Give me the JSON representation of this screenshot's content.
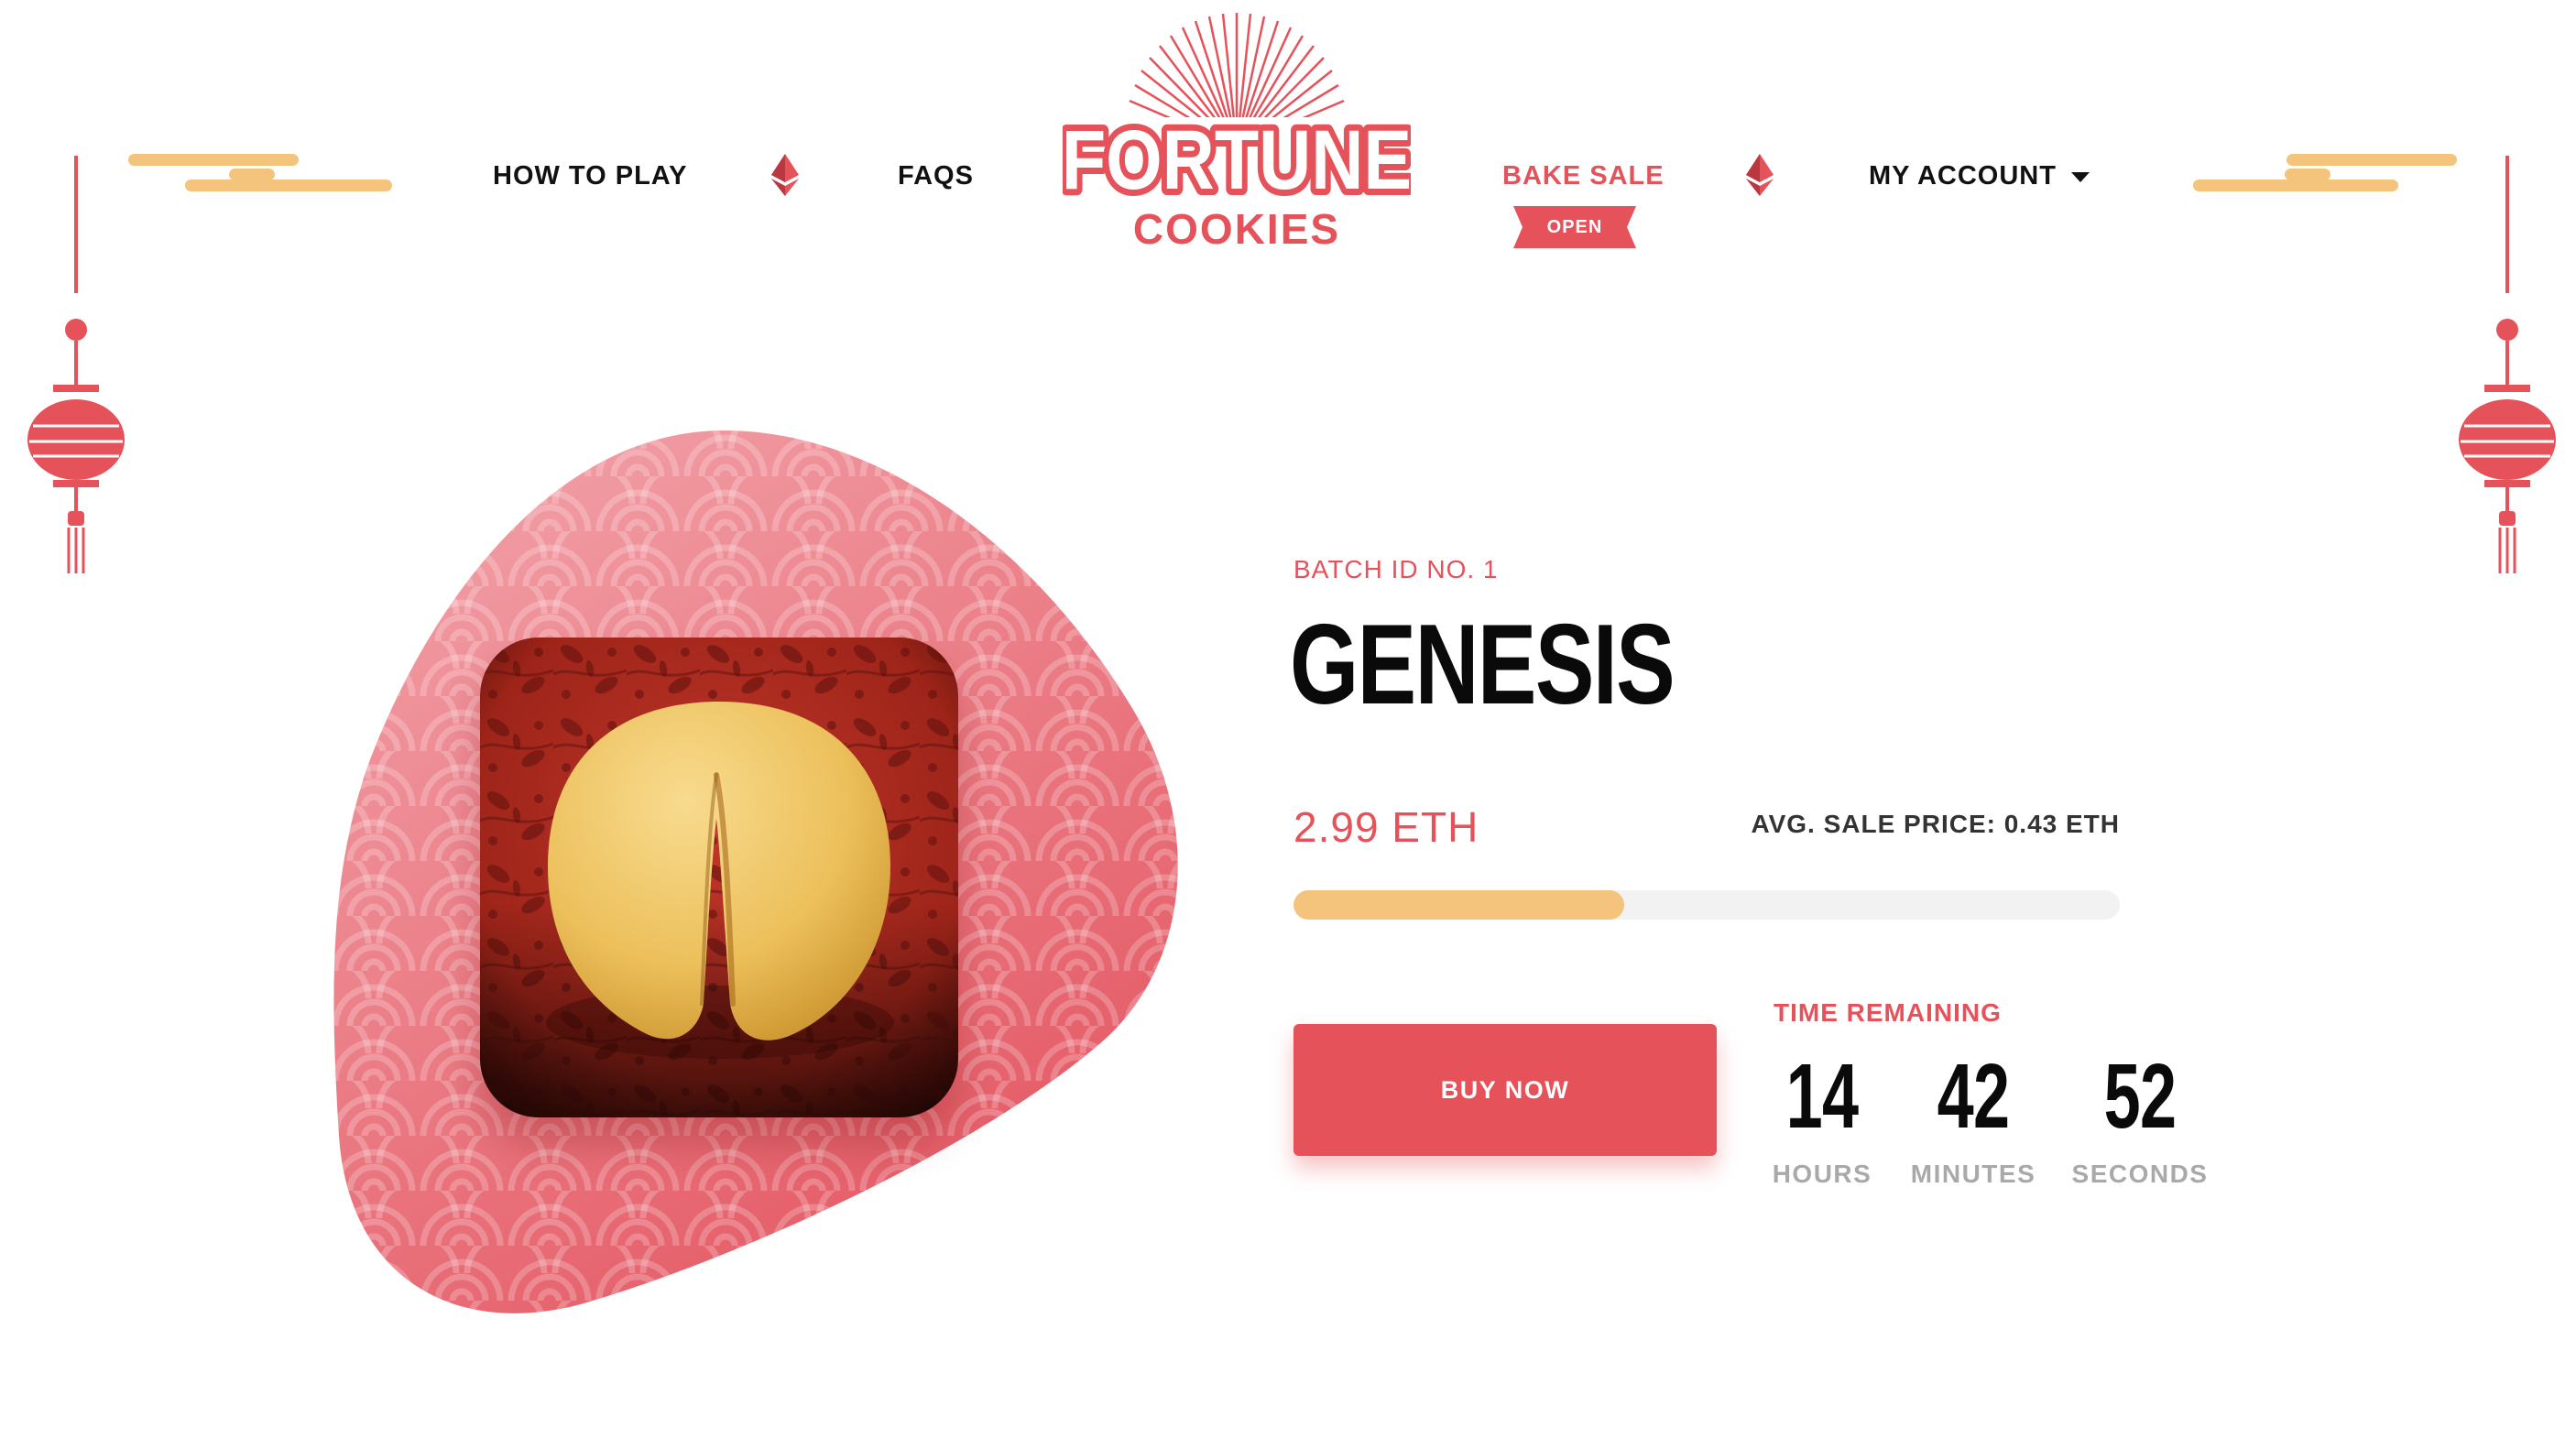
{
  "colors": {
    "accent": "#e5525a",
    "gold": "#f4c37c",
    "text": "#111111",
    "muted": "#a9a9a9"
  },
  "logo": {
    "word1": "FORTUNE",
    "word2": "COOKIES"
  },
  "nav": {
    "how_to_play": "HOW TO PLAY",
    "faqs": "FAQS",
    "bake_sale": "BAKE SALE",
    "bake_sale_badge": "OPEN",
    "my_account": "MY ACCOUNT",
    "divider_icon": "ethereum-diamond-icon",
    "account_icon": "caret-down-icon"
  },
  "decor": {
    "cloud_icon": "cloud-icon",
    "lantern_icon": "lantern-icon"
  },
  "artwork": {
    "subject_icon": "fortune-cookie-icon"
  },
  "batch": {
    "label": "BATCH ID NO. 1",
    "name": "GENESIS",
    "price": "2.99 ETH",
    "avg_price": "AVG. SALE PRICE: 0.43 ETH",
    "progress_fraction": 0.4
  },
  "buy_button": "BUY NOW",
  "countdown": {
    "label": "TIME REMAINING",
    "hours": "14",
    "hours_label": "HOURS",
    "minutes": "42",
    "minutes_label": "MINUTES",
    "seconds": "52",
    "seconds_label": "SECONDS"
  }
}
